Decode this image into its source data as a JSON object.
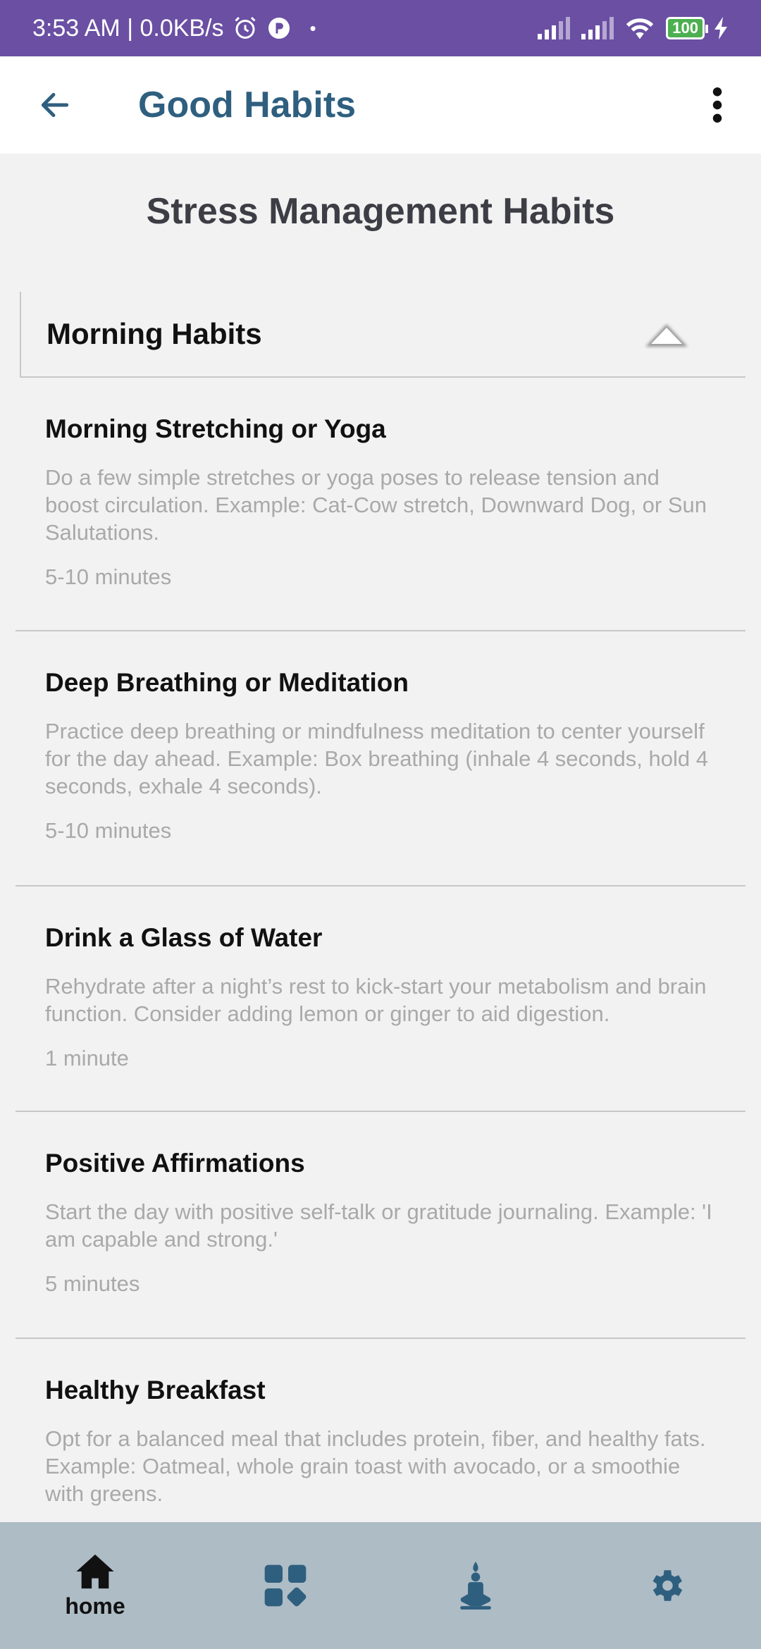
{
  "status_bar": {
    "time_speed": "3:53 AM | 0.0KB/s",
    "dot": "•",
    "battery": "100"
  },
  "app_bar": {
    "title": "Good Habits",
    "back_icon": "arrow-left-icon",
    "more_icon": "more-vertical-icon"
  },
  "page": {
    "heading": "Stress Management Habits"
  },
  "section": {
    "title": "Morning Habits",
    "toggle_icon": "chevron-up-icon",
    "expanded": true
  },
  "habits": [
    {
      "title": "Morning Stretching or Yoga",
      "description": "Do a few simple stretches or yoga poses to release tension and boost circulation. Example: Cat-Cow stretch, Downward Dog, or Sun Salutations.",
      "duration": "5-10 minutes"
    },
    {
      "title": "Deep Breathing or Meditation",
      "description": "Practice deep breathing or mindfulness meditation to center yourself for the day ahead. Example: Box breathing (inhale 4 seconds, hold 4 seconds, exhale 4 seconds).",
      "duration": "5-10 minutes"
    },
    {
      "title": "Drink a Glass of Water",
      "description": "Rehydrate after a night’s rest to kick-start your metabolism and brain function. Consider adding lemon or ginger to aid digestion.",
      "duration": "1 minute"
    },
    {
      "title": "Positive Affirmations",
      "description": "Start the day with positive self-talk or gratitude journaling. Example: 'I am capable and strong.'",
      "duration": "5 minutes"
    },
    {
      "title": "Healthy Breakfast",
      "description": "Opt for a balanced meal that includes protein, fiber, and healthy fats. Example: Oatmeal, whole grain toast with avocado, or a smoothie with greens.",
      "duration": ""
    }
  ],
  "bottom_nav": {
    "items": [
      {
        "label": "home",
        "icon": "home-icon",
        "active": true
      },
      {
        "label": "",
        "icon": "categories-icon",
        "active": false
      },
      {
        "label": "",
        "icon": "meditation-icon",
        "active": false
      },
      {
        "label": "",
        "icon": "settings-icon",
        "active": false
      }
    ]
  },
  "colors": {
    "status_bar": "#6a4fa3",
    "title_accent": "#2f5f7f",
    "nav_background": "#aebcc5",
    "nav_icon": "#2f5f7f"
  }
}
